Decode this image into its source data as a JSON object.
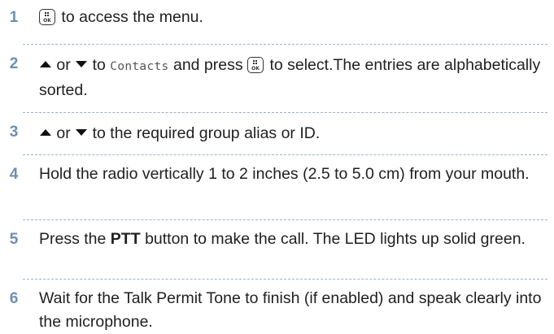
{
  "steps": [
    {
      "num": "1",
      "text_a": "to access the menu."
    },
    {
      "num": "2",
      "or": "or",
      "text_a": "to",
      "menu_item": "Contacts",
      "text_b": "and press",
      "text_c": "to select.The entries are alphabetically sorted."
    },
    {
      "num": "3",
      "or": "or",
      "text_a": "to the required group alias or ID."
    },
    {
      "num": "4",
      "text_a": "Hold the radio vertically 1 to 2 inches (2.5 to 5.0 cm) from your mouth."
    },
    {
      "num": "5",
      "text_a": "Press the",
      "bold": "PTT",
      "text_b": "button to make the call. The LED lights up solid green."
    },
    {
      "num": "6",
      "text_a": "Wait for the Talk Permit Tone to finish (if enabled) and speak clearly into the microphone."
    }
  ],
  "icons": {
    "menu_ok": "menu-ok-button-icon",
    "up": "up-arrow-icon",
    "down": "down-arrow-icon"
  },
  "colors": {
    "step_number": "#6d8fb2",
    "separator": "#9ab4c9",
    "text": "#1f1f1f"
  }
}
